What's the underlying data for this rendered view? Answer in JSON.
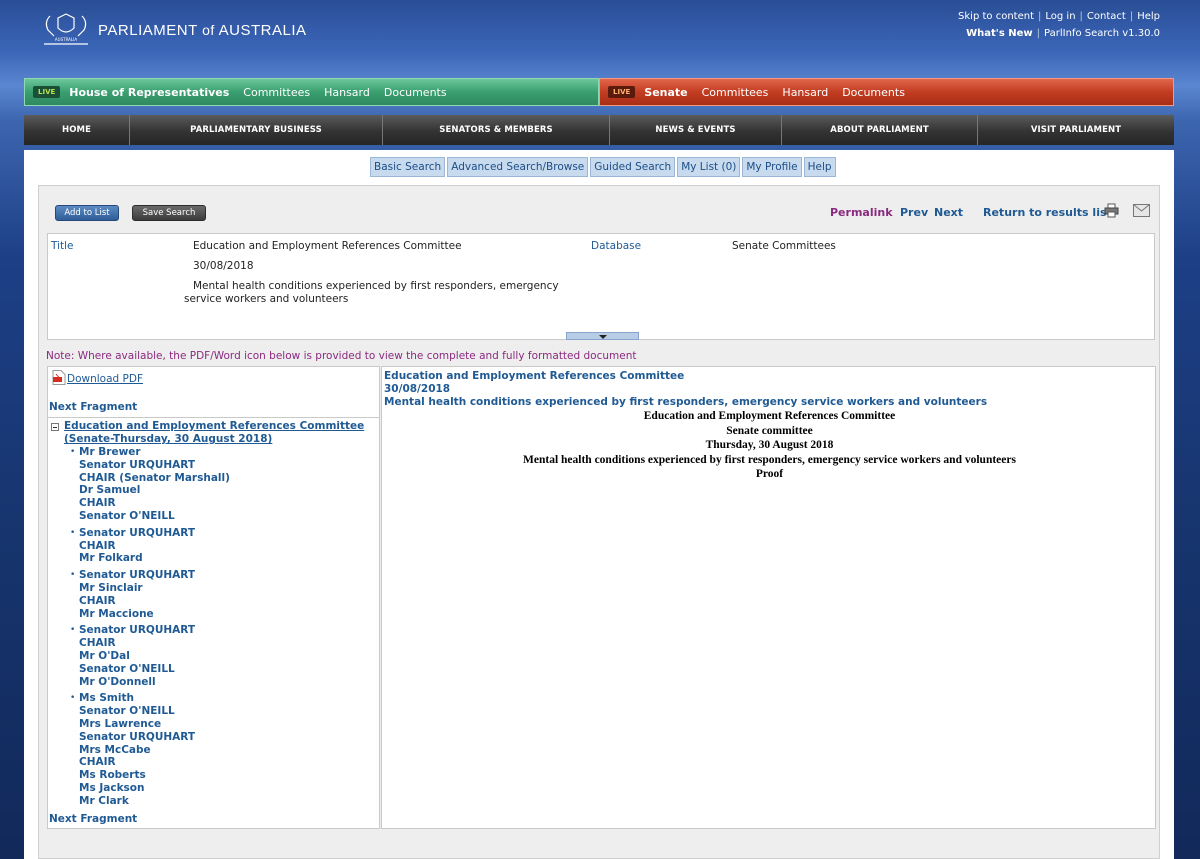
{
  "brand": {
    "crest_text": "AUSTRALIA",
    "title_a": "PARLIAMENT",
    "title_of": "of",
    "title_b": "AUSTRALIA"
  },
  "toplinks": {
    "skip": "Skip to content",
    "login": "Log in",
    "contact": "Contact",
    "help": "Help",
    "whats_new": "What's New",
    "version": "ParlInfo Search v1.30.0"
  },
  "house": {
    "live": "LIVE",
    "name": "House of Representatives",
    "links": [
      "Committees",
      "Hansard",
      "Documents"
    ]
  },
  "senate": {
    "live": "LIVE",
    "name": "Senate",
    "links": [
      "Committees",
      "Hansard",
      "Documents"
    ]
  },
  "mainnav": [
    "HOME",
    "PARLIAMENTARY BUSINESS",
    "SENATORS & MEMBERS",
    "NEWS & EVENTS",
    "ABOUT PARLIAMENT",
    "VISIT PARLIAMENT"
  ],
  "searchtabs": [
    "Basic Search",
    "Advanced Search/Browse",
    "Guided Search",
    "My List (0)",
    "My Profile",
    "Help"
  ],
  "toolbar": {
    "add_to_list": "Add to List",
    "save_search": "Save Search",
    "permalink": "Permalink",
    "prev": "Prev",
    "next": "Next",
    "return": "Return to results list"
  },
  "meta": {
    "title_label": "Title",
    "title_value": "Education and Employment References Committee",
    "date_value": "30/08/2018",
    "desc_value": "Mental health conditions experienced by first responders, emergency service workers and volunteers",
    "database_label": "Database",
    "database_value": "Senate Committees"
  },
  "note": "Note: Where available, the PDF/Word icon below is provided to view the complete and fully formatted document",
  "left": {
    "download_pdf": "Download PDF",
    "next_fragment": "Next Fragment",
    "tree_title_1": "Education and Employment References Committee",
    "tree_title_2": "(Senate-Thursday, 30 August 2018)",
    "groups": [
      [
        "Mr Brewer",
        "Senator URQUHART",
        "CHAIR (Senator Marshall)",
        "Dr Samuel",
        "CHAIR",
        "Senator O'NEILL"
      ],
      [
        "Senator URQUHART",
        "CHAIR",
        "Mr Folkard"
      ],
      [
        "Senator URQUHART",
        "Mr Sinclair",
        "CHAIR",
        "Mr Maccione"
      ],
      [
        "Senator URQUHART",
        "CHAIR",
        "Mr O'Dal",
        "Senator O'NEILL",
        "Mr O'Donnell"
      ],
      [
        "Ms Smith",
        "Senator O'NEILL",
        "Mrs Lawrence",
        "Senator URQUHART",
        "Mrs McCabe",
        "CHAIR",
        "Ms Roberts",
        "Ms Jackson",
        "Mr Clark"
      ]
    ]
  },
  "doc": {
    "head": [
      "Education and Employment References Committee",
      "30/08/2018",
      "Mental health conditions experienced by first responders, emergency service workers and volunteers"
    ],
    "body": [
      "Education and Employment References Committee",
      "Senate committee",
      "Thursday, 30 August 2018",
      "Mental health conditions experienced by first responders, emergency service workers and volunteers",
      "Proof"
    ]
  }
}
